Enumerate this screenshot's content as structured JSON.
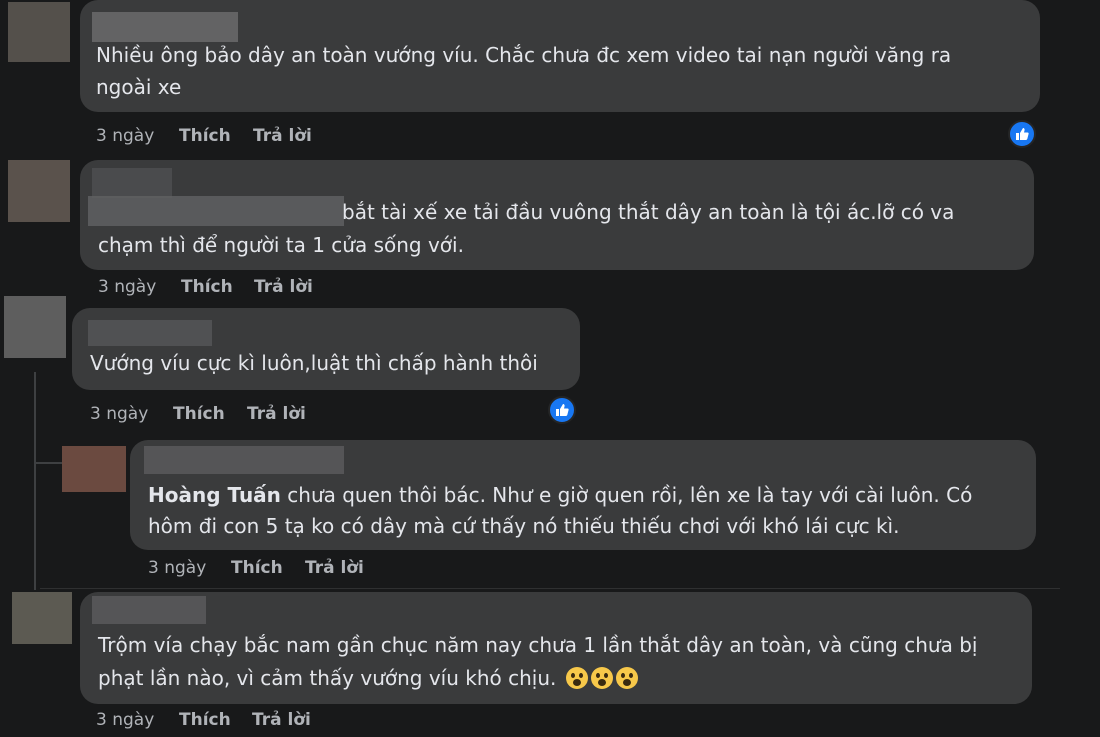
{
  "comments": [
    {
      "name": "",
      "text_lines": [
        "Nhiều ông bảo dây an toàn vướng víu. Chắc chưa đc xem video tai nạn người văng ra",
        "ngoài xe"
      ],
      "time": "3 ngày",
      "like_label": "Thích",
      "reply_label": "Trả lời",
      "liked": true
    },
    {
      "name": "",
      "text_lines": [
        "bắt tài xế xe tải đầu vuông thắt dây an toàn là tội ác.lỡ có va",
        "chạm thì để người ta 1 cửa sống với."
      ],
      "time": "3 ngày",
      "like_label": "Thích",
      "reply_label": "Trả lời",
      "liked": false
    },
    {
      "name": "",
      "text_lines": [
        "Vướng víu cực kì luôn,luật thì chấp hành thôi"
      ],
      "time": "3 ngày",
      "like_label": "Thích",
      "reply_label": "Trả lời",
      "liked": true
    },
    {
      "name": "",
      "mention": "Hoàng Tuấn",
      "text_lines": [
        " chưa quen thôi bác. Như e giờ quen rồi, lên xe là tay với cài luôn. Có",
        "hôm đi con 5 tạ ko có dây mà cứ thấy nó thiếu thiếu chơi với khó lái cực kì."
      ],
      "time": "3 ngày",
      "like_label": "Thích",
      "reply_label": "Trả lời",
      "liked": false
    },
    {
      "name": "",
      "text_lines": [
        "Trộm vía chạy bắc nam gần chục năm nay chưa 1 lần thắt dây an toàn, và cũng chưa bị",
        "phạt lần nào, vì cảm thấy vướng víu khó chịu."
      ],
      "emojis": [
        "astonished-face-icon",
        "astonished-face-icon",
        "astonished-face-icon"
      ],
      "time": "3 ngày",
      "like_label": "Thích",
      "reply_label": "Trả lời",
      "liked": false
    }
  ],
  "colors": {
    "background": "#18191a",
    "bubble": "#3a3b3c",
    "text": "#e4e6eb",
    "secondary_text": "#b0b3b8",
    "like_blue": "#1877f2"
  }
}
